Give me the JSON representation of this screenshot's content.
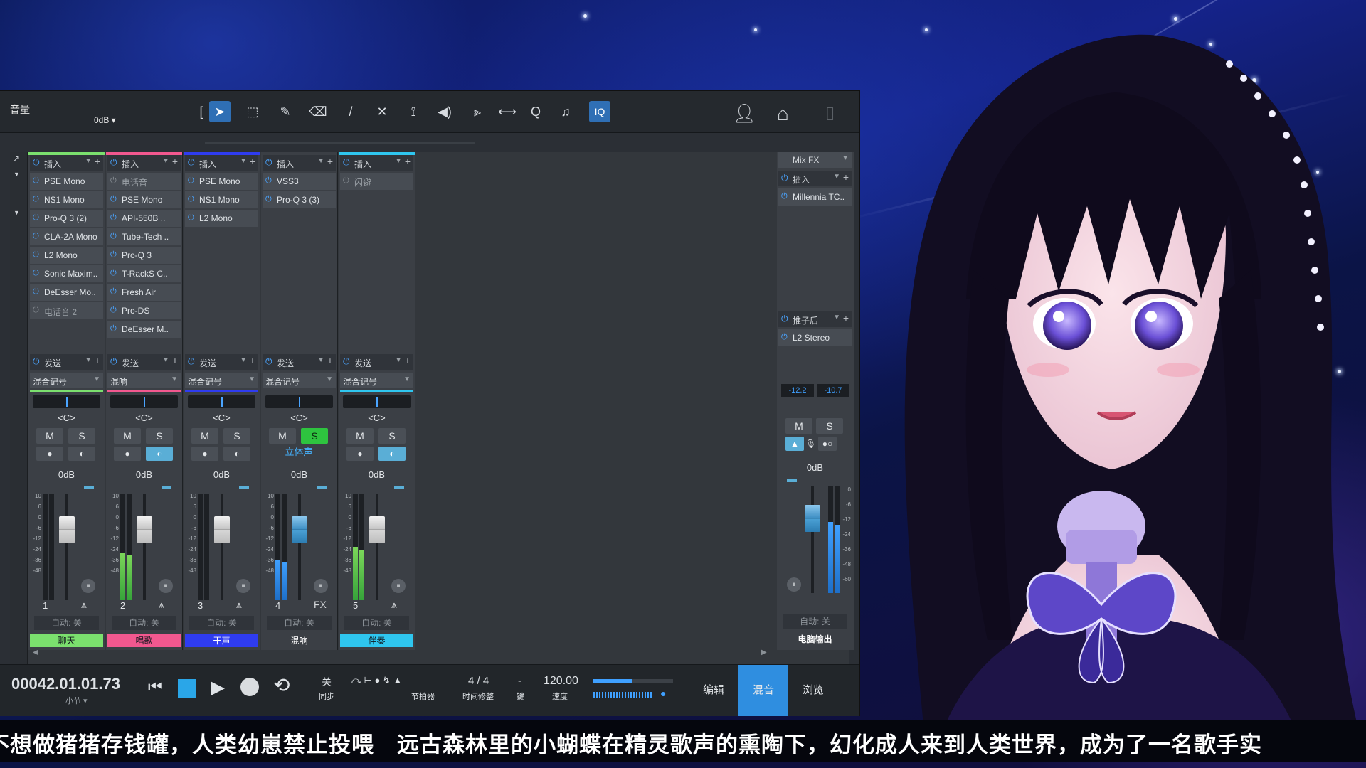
{
  "toolbar": {
    "title": "音量",
    "db": "0dB ▾",
    "tools": [
      {
        "name": "arrow-tool-icon",
        "glyph": "➤",
        "active": true
      },
      {
        "name": "range-tool-icon",
        "glyph": "⬚",
        "active": false
      },
      {
        "name": "split-tool-icon",
        "glyph": "✎",
        "active": false
      },
      {
        "name": "eraser-tool-icon",
        "glyph": "⌫",
        "active": false
      },
      {
        "name": "paint-tool-icon",
        "glyph": "/",
        "active": false
      },
      {
        "name": "mute-tool-icon",
        "glyph": "✕",
        "active": false
      },
      {
        "name": "bend-tool-icon",
        "glyph": "⟟",
        "active": false
      },
      {
        "name": "listen-tool-icon",
        "glyph": "◀)",
        "active": false
      },
      {
        "name": "snap-icon",
        "glyph": "⫸",
        "active": false
      },
      {
        "name": "quantize-icon",
        "glyph": "⟷",
        "active": false
      },
      {
        "name": "zoom-icon",
        "glyph": "Q",
        "active": false
      },
      {
        "name": "metronome-icon",
        "glyph": "♫",
        "active": false
      }
    ],
    "iq_label": "IQ"
  },
  "channels": [
    {
      "num": "1",
      "name": "聊天",
      "color": "#7be06e",
      "ico": "⩚",
      "insert_label": "插入",
      "plugins": [
        {
          "n": "PSE Mono",
          "on": true
        },
        {
          "n": "NS1 Mono",
          "on": true
        },
        {
          "n": "Pro-Q 3 (2)",
          "on": true
        },
        {
          "n": "CLA-2A Mono",
          "on": true
        },
        {
          "n": "L2 Mono",
          "on": true
        },
        {
          "n": "Sonic Maxim..",
          "on": true
        },
        {
          "n": "DeEsser Mo..",
          "on": true
        },
        {
          "n": "电话音 2",
          "on": false
        }
      ],
      "send_label": "发送",
      "dest": "混合记号",
      "pan": "<C>",
      "vol": "0dB",
      "auto": "自动: 关",
      "solo": false,
      "stereo": "",
      "fader_blue": false,
      "meter": 0.0
    },
    {
      "num": "2",
      "name": "唱歌",
      "color": "#f2588f",
      "ico": "⩚",
      "insert_label": "插入",
      "plugins": [
        {
          "n": "电话音",
          "on": false
        },
        {
          "n": "PSE Mono",
          "on": true
        },
        {
          "n": "API-550B ..",
          "on": true
        },
        {
          "n": "Tube-Tech ..",
          "on": true
        },
        {
          "n": "Pro-Q 3",
          "on": true
        },
        {
          "n": "T-RackS C..",
          "on": true
        },
        {
          "n": "Fresh Air",
          "on": true
        },
        {
          "n": "Pro-DS",
          "on": true
        },
        {
          "n": "DeEsser M..",
          "on": true
        }
      ],
      "send_label": "发送",
      "dest": "混响",
      "pan": "<C>",
      "vol": "0dB",
      "auto": "自动: 关",
      "solo": false,
      "stereo": "",
      "fader_blue": false,
      "meter": 0.45
    },
    {
      "num": "3",
      "name": "干声",
      "color": "#2f3cf0",
      "ico": "⩚",
      "insert_label": "插入",
      "plugins": [
        {
          "n": "PSE Mono",
          "on": true
        },
        {
          "n": "NS1 Mono",
          "on": true
        },
        {
          "n": "L2 Mono",
          "on": true
        }
      ],
      "send_label": "发送",
      "dest": "混合记号",
      "pan": "<C>",
      "vol": "0dB",
      "auto": "自动: 关",
      "solo": false,
      "stereo": "",
      "fader_blue": false,
      "meter": 0.0
    },
    {
      "num": "4",
      "name": "混响",
      "color": "#3b3f45",
      "ico": "FX",
      "insert_label": "插入",
      "plugins": [
        {
          "n": "VSS3",
          "on": true
        },
        {
          "n": "Pro-Q 3 (3)",
          "on": true
        }
      ],
      "send_label": "发送",
      "dest": "混合记号",
      "pan": "<C>",
      "vol": "0dB",
      "auto": "自动: 关",
      "solo": true,
      "stereo": "立体声",
      "fader_blue": true,
      "meter": 0.38
    },
    {
      "num": "5",
      "name": "伴奏",
      "color": "#2fc6ef",
      "ico": "⩚",
      "insert_label": "插入",
      "plugins": [
        {
          "n": "闪避",
          "on": false
        }
      ],
      "send_label": "发送",
      "dest": "混合记号",
      "pan": "<C>",
      "vol": "0dB",
      "auto": "自动: 关",
      "solo": false,
      "stereo": "",
      "fader_blue": false,
      "meter": 0.5
    }
  ],
  "scale_ticks": [
    "10",
    "6",
    "0",
    "-6",
    "-12",
    "-24",
    "-36",
    "-48"
  ],
  "bus": {
    "header": "Mix FX",
    "insert_label": "插入",
    "plugins": [
      {
        "n": "Millennia TC..",
        "on": true
      }
    ],
    "post_label": "推子后",
    "post_plugins": [
      {
        "n": "L2 Stereo",
        "on": true
      }
    ],
    "peak_l": "-12.2",
    "peak_r": "-10.7",
    "vol": "0dB",
    "auto": "自动: 关",
    "name": "电脑输出",
    "scale": [
      "0",
      "-6",
      "-12",
      "-24",
      "-36",
      "-48",
      "-60"
    ]
  },
  "transport": {
    "time": "00042.01.01.73",
    "time_unit": "小节 ▾",
    "sync_top": "关",
    "sync_bottom": "同步",
    "metronome": "节拍器",
    "sig": "4 / 4",
    "sig_label": "时间修整",
    "key": "-",
    "key_label": "键",
    "tempo": "120.00",
    "tempo_label": "速度",
    "tabs": [
      "编辑",
      "混音",
      "浏览"
    ],
    "active_tab": 1
  },
  "subtitle": "不想做猪猪存钱罐，人类幼崽禁止投喂　远古森林里的小蝴蝶在精灵歌声的熏陶下，幻化成人来到人类世界，成为了一名歌手实"
}
